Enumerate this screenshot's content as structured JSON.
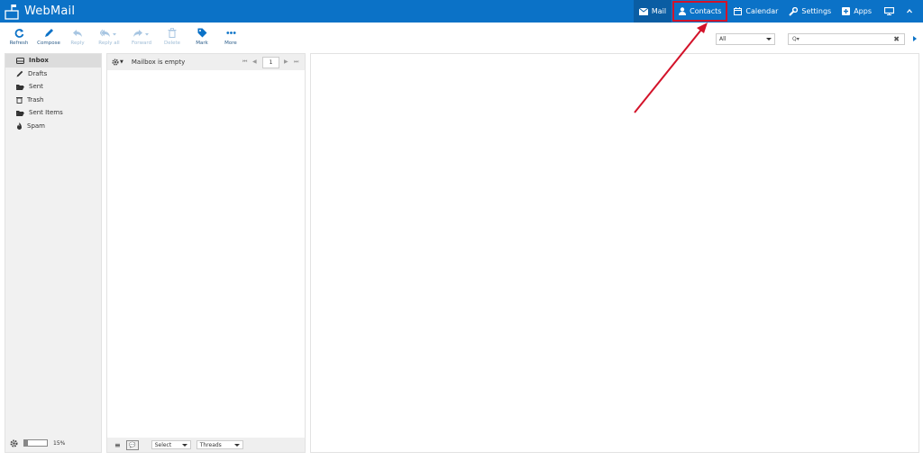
{
  "app": {
    "title": "WebMail"
  },
  "topnav": [
    {
      "label": "Mail",
      "icon": "envelope-icon"
    },
    {
      "label": "Contacts",
      "icon": "user-icon"
    },
    {
      "label": "Calendar",
      "icon": "calendar-icon"
    },
    {
      "label": "Settings",
      "icon": "wrench-icon"
    },
    {
      "label": "Apps",
      "icon": "plus-square-icon"
    }
  ],
  "toolbar": {
    "buttons": [
      {
        "label": "Refresh",
        "icon": "refresh-icon",
        "enabled": true
      },
      {
        "label": "Compose",
        "icon": "pencil-icon",
        "enabled": true
      },
      {
        "label": "Reply",
        "icon": "reply-icon",
        "enabled": false
      },
      {
        "label": "Reply all",
        "icon": "reply-all-icon",
        "enabled": false
      },
      {
        "label": "Forward",
        "icon": "forward-icon",
        "enabled": false
      },
      {
        "label": "Delete",
        "icon": "trash-icon",
        "enabled": false
      },
      {
        "label": "Mark",
        "icon": "tag-icon",
        "enabled": true
      },
      {
        "label": "More",
        "icon": "more-icon",
        "enabled": true
      }
    ],
    "filter_value": "All",
    "search_icon_text": "Q▾",
    "search_value": ""
  },
  "folders": [
    {
      "label": "Inbox",
      "icon": "inbox-icon"
    },
    {
      "label": "Drafts",
      "icon": "pencil-icon"
    },
    {
      "label": "Sent",
      "icon": "folder-open-icon"
    },
    {
      "label": "Trash",
      "icon": "trash-icon"
    },
    {
      "label": "Sent Items",
      "icon": "folder-open-icon"
    },
    {
      "label": "Spam",
      "icon": "fire-icon"
    }
  ],
  "sidebar_footer": {
    "quota_percent": 15,
    "quota_label": "15%"
  },
  "message_list": {
    "status": "Mailbox is empty",
    "page": "1",
    "select_label": "Select",
    "threads_label": "Threads"
  },
  "colors": {
    "topbar": "#0b72c7",
    "annotation": "#d3132a"
  }
}
